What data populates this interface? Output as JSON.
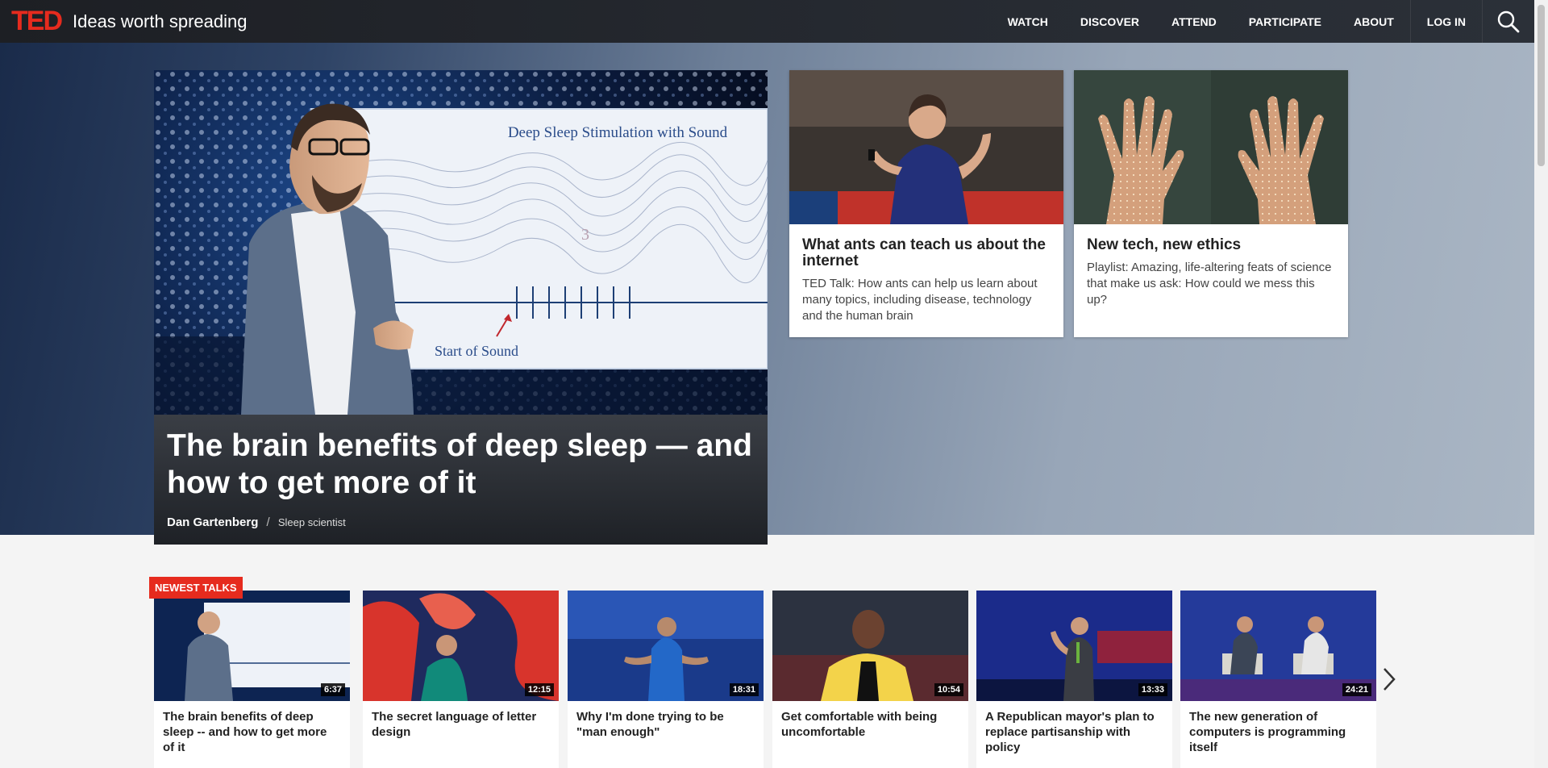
{
  "header": {
    "logo": "TED",
    "tagline": "Ideas worth spreading",
    "nav": [
      "WATCH",
      "DISCOVER",
      "ATTEND",
      "PARTICIPATE",
      "ABOUT",
      "LOG IN"
    ],
    "search_icon": "search-icon"
  },
  "hero": {
    "title": "The brain benefits of deep sleep — and how to get more of it",
    "speaker": "Dan Gartenberg",
    "separator": "/",
    "role": "Sleep scientist",
    "image_text": {
      "heading": "Deep Sleep Stimulation with Sound",
      "marker": "Start of Sound",
      "number": "3"
    }
  },
  "cards": [
    {
      "title": "What ants can teach us about the internet",
      "desc": "TED Talk: How ants can help us learn about many topics, including disease, technology and the human brain"
    },
    {
      "title": "New tech, new ethics",
      "desc": "Playlist: Amazing, life-altering feats of science that make us ask: How could we mess this up?"
    }
  ],
  "newest": {
    "badge": "NEWEST TALKS",
    "talks": [
      {
        "title": "The brain benefits of deep sleep -- and how to get more of it",
        "duration": "6:37"
      },
      {
        "title": "The secret language of letter design",
        "duration": "12:15"
      },
      {
        "title": "Why I'm done trying to be \"man enough\"",
        "duration": "18:31"
      },
      {
        "title": "Get comfortable with being uncomfortable",
        "duration": "10:54"
      },
      {
        "title": "A Republican mayor's plan to replace partisanship with policy",
        "duration": "13:33"
      },
      {
        "title": "The new generation of computers is programming itself",
        "duration": "24:21"
      }
    ],
    "next_icon": "chevron-right-icon"
  },
  "colors": {
    "ted_red": "#e62b1e",
    "header_bg": "#1d1f24"
  }
}
